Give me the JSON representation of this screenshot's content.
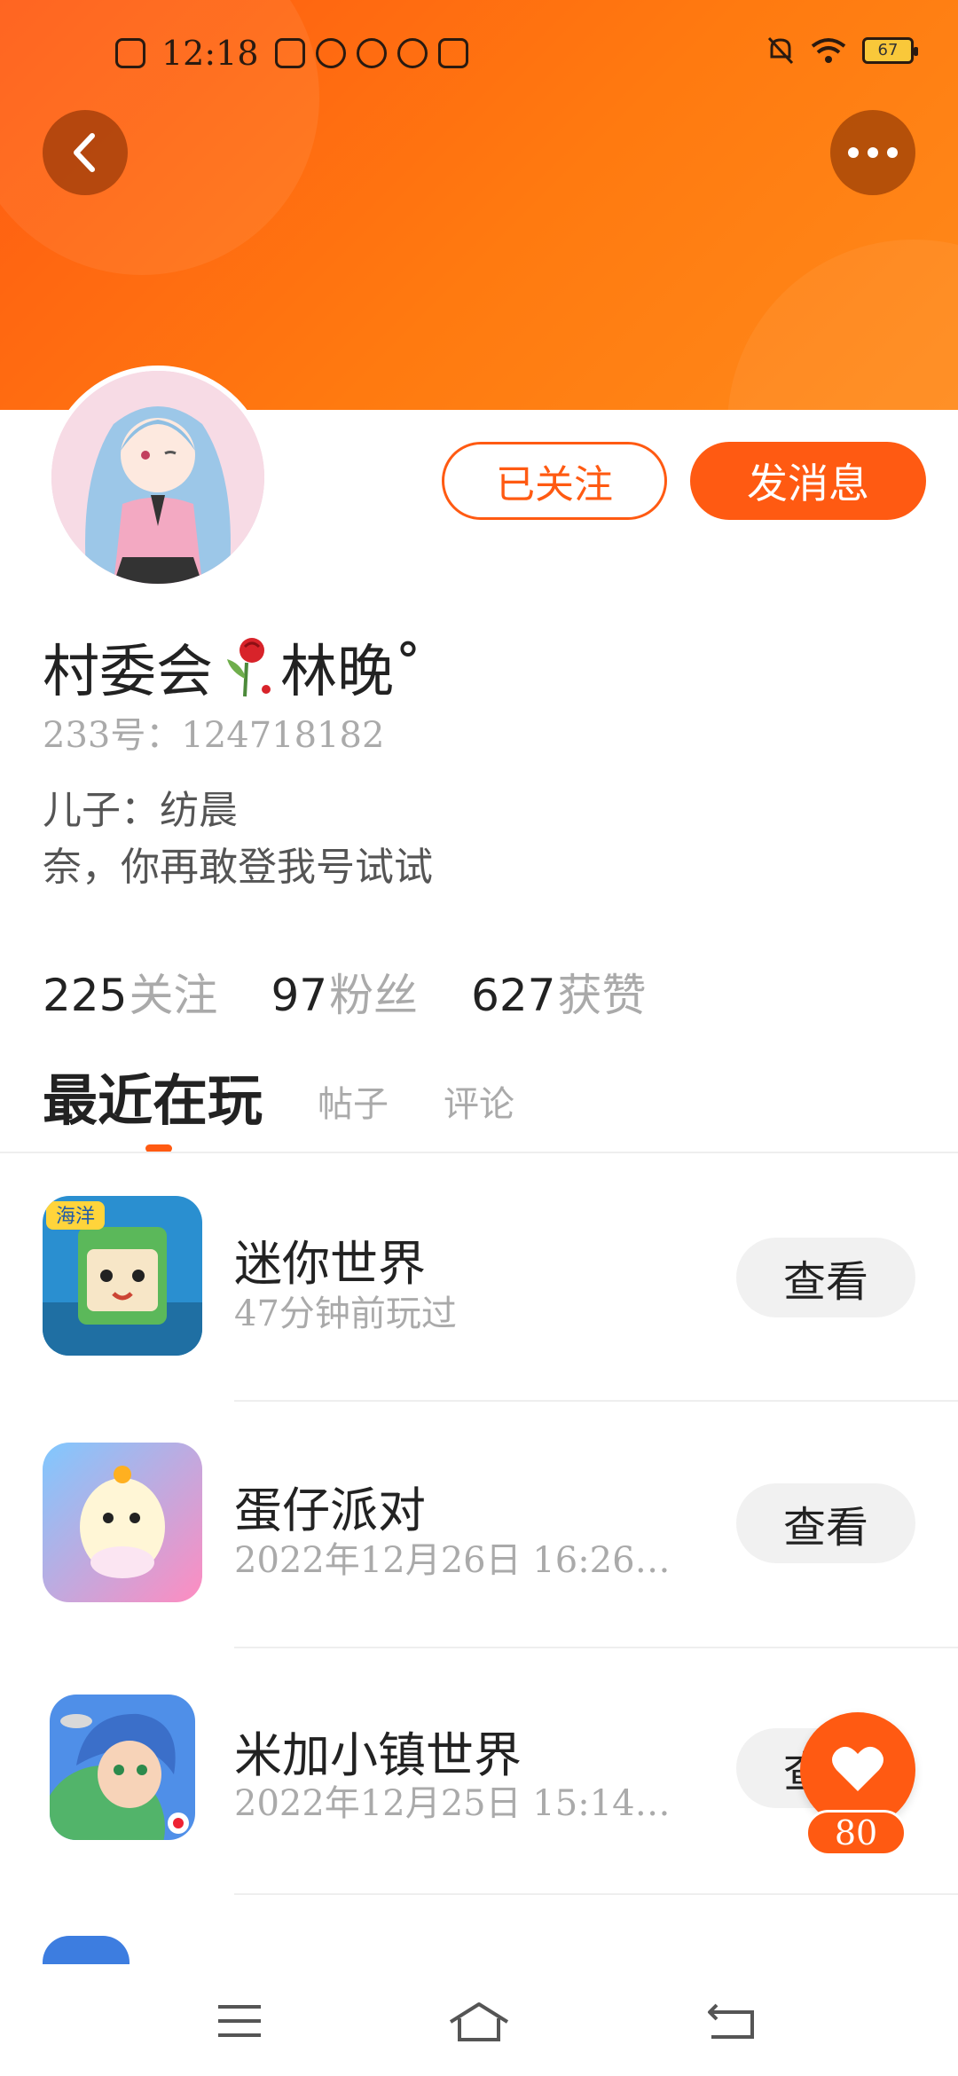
{
  "status_bar": {
    "time": "12:18",
    "battery": "67"
  },
  "profile": {
    "nickname_part1": "村委会",
    "nickname_part2": "林晚˚",
    "user_id": "233号：124718182",
    "bio_line1": "儿子：纺晨",
    "bio_line2": "奈，你再敢登我号试试",
    "followed_label": "已关注",
    "message_label": "发消息"
  },
  "stats": {
    "following_count": "225",
    "following_label": "关注",
    "fans_count": "97",
    "fans_label": "粉丝",
    "likes_count": "627",
    "likes_label": "获赞"
  },
  "tabs": [
    "最近在玩",
    "帖子",
    "评论"
  ],
  "games": [
    {
      "name": "迷你世界",
      "time": "47分钟前玩过",
      "button": "查看"
    },
    {
      "name": "蛋仔派对",
      "time": "2022年12月26日 16:26…",
      "button": "查看"
    },
    {
      "name": "米加小镇世界",
      "time": "2022年12月25日 15:14…",
      "button": "查看"
    }
  ],
  "game_icon_badges": {
    "mini_world": "海洋"
  },
  "like_fab": {
    "count": "80"
  },
  "colors": {
    "accent": "#ff5a12",
    "header_gradient_start": "#ff5a12",
    "header_gradient_end": "#ff8a1a"
  },
  "icons": [
    "back-arrow-icon",
    "more-dots-icon",
    "heart-icon",
    "menu-icon",
    "home-icon",
    "return-icon"
  ]
}
